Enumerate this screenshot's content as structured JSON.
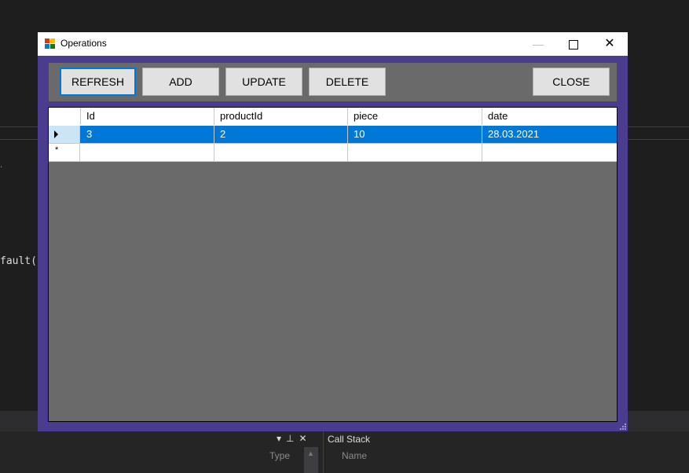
{
  "ide": {
    "code_fragment": "fault(",
    "dot": ".",
    "panel": {
      "call_stack_title": "Call Stack",
      "col_type": "Type",
      "col_name": "Name"
    }
  },
  "window": {
    "title": "Operations",
    "controls": {
      "minimize": "—",
      "close": "✕"
    }
  },
  "toolbar": {
    "refresh": "REFRESH",
    "add": "ADD",
    "update": "UPDATE",
    "delete": "DELETE",
    "close": "CLOSE"
  },
  "grid": {
    "columns": [
      "Id",
      "productId",
      "piece",
      "date"
    ],
    "rows": [
      [
        "3",
        "2",
        "10",
        "28.03.2021"
      ]
    ],
    "new_row_marker": "*"
  },
  "colors": {
    "window_border": "#4b3c8f",
    "grid_background": "#6a6a6a",
    "selection": "#0078d7"
  }
}
